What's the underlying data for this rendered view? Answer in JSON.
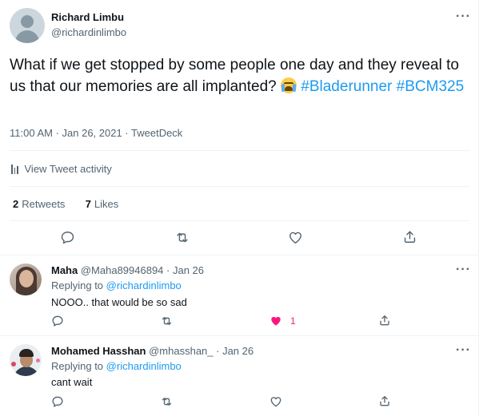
{
  "main_tweet": {
    "author_name": "Richard Limbu",
    "author_handle": "@richardinlimbo",
    "text_plain": "What if we get stopped by some people one day and they reveal to us that our memories are all implanted?",
    "emoji": "loudly-crying-face-emoji",
    "hashtags": [
      "#Bladerunner",
      "#BCM325"
    ],
    "meta": "11:00 AM · Jan 26, 2021 · TweetDeck",
    "activity_label": "View Tweet activity",
    "retweets_count": "2",
    "retweets_label": "Retweets",
    "likes_count": "7",
    "likes_label": "Likes",
    "actions": [
      "reply-icon",
      "retweet-icon",
      "like-icon",
      "share-icon"
    ]
  },
  "replies": [
    {
      "name": "Maha",
      "handle": "@Maha89946894",
      "date": "· Jan 26",
      "replying_prefix": "Replying to",
      "replying_to": "@richardinlimbo",
      "text": "NOOO.. that would be so sad",
      "like_count": "1",
      "liked": true
    },
    {
      "name": "Mohamed Hasshan",
      "handle": "@mhasshan_",
      "date": "· Jan 26",
      "replying_prefix": "Replying to",
      "replying_to": "@richardinlimbo",
      "text": "cant wait",
      "like_count": "",
      "liked": false
    }
  ],
  "colors": {
    "accent": "#1d9bf0",
    "like_active": "#f91880",
    "muted_text": "#536471",
    "primary_text": "#0f1419",
    "divider": "#eff3f4"
  }
}
